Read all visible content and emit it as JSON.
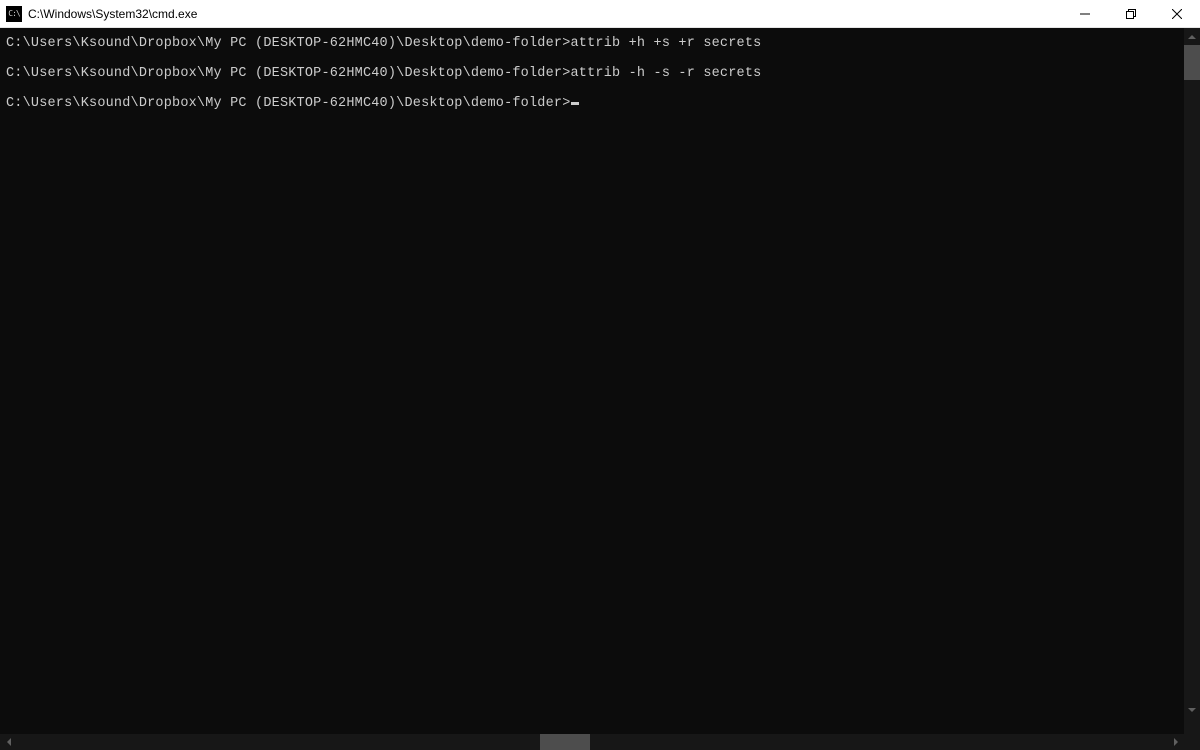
{
  "window": {
    "title": "C:\\Windows\\System32\\cmd.exe",
    "icon_label": "C:\\"
  },
  "terminal": {
    "lines": [
      {
        "prompt": "C:\\Users\\Ksound\\Dropbox\\My PC (DESKTOP-62HMC40)\\Desktop\\demo-folder>",
        "command": "attrib +h +s +r secrets"
      },
      {
        "prompt": "C:\\Users\\Ksound\\Dropbox\\My PC (DESKTOP-62HMC40)\\Desktop\\demo-folder>",
        "command": "attrib -h -s -r secrets"
      }
    ],
    "current_prompt": "C:\\Users\\Ksound\\Dropbox\\My PC (DESKTOP-62HMC40)\\Desktop\\demo-folder>"
  }
}
